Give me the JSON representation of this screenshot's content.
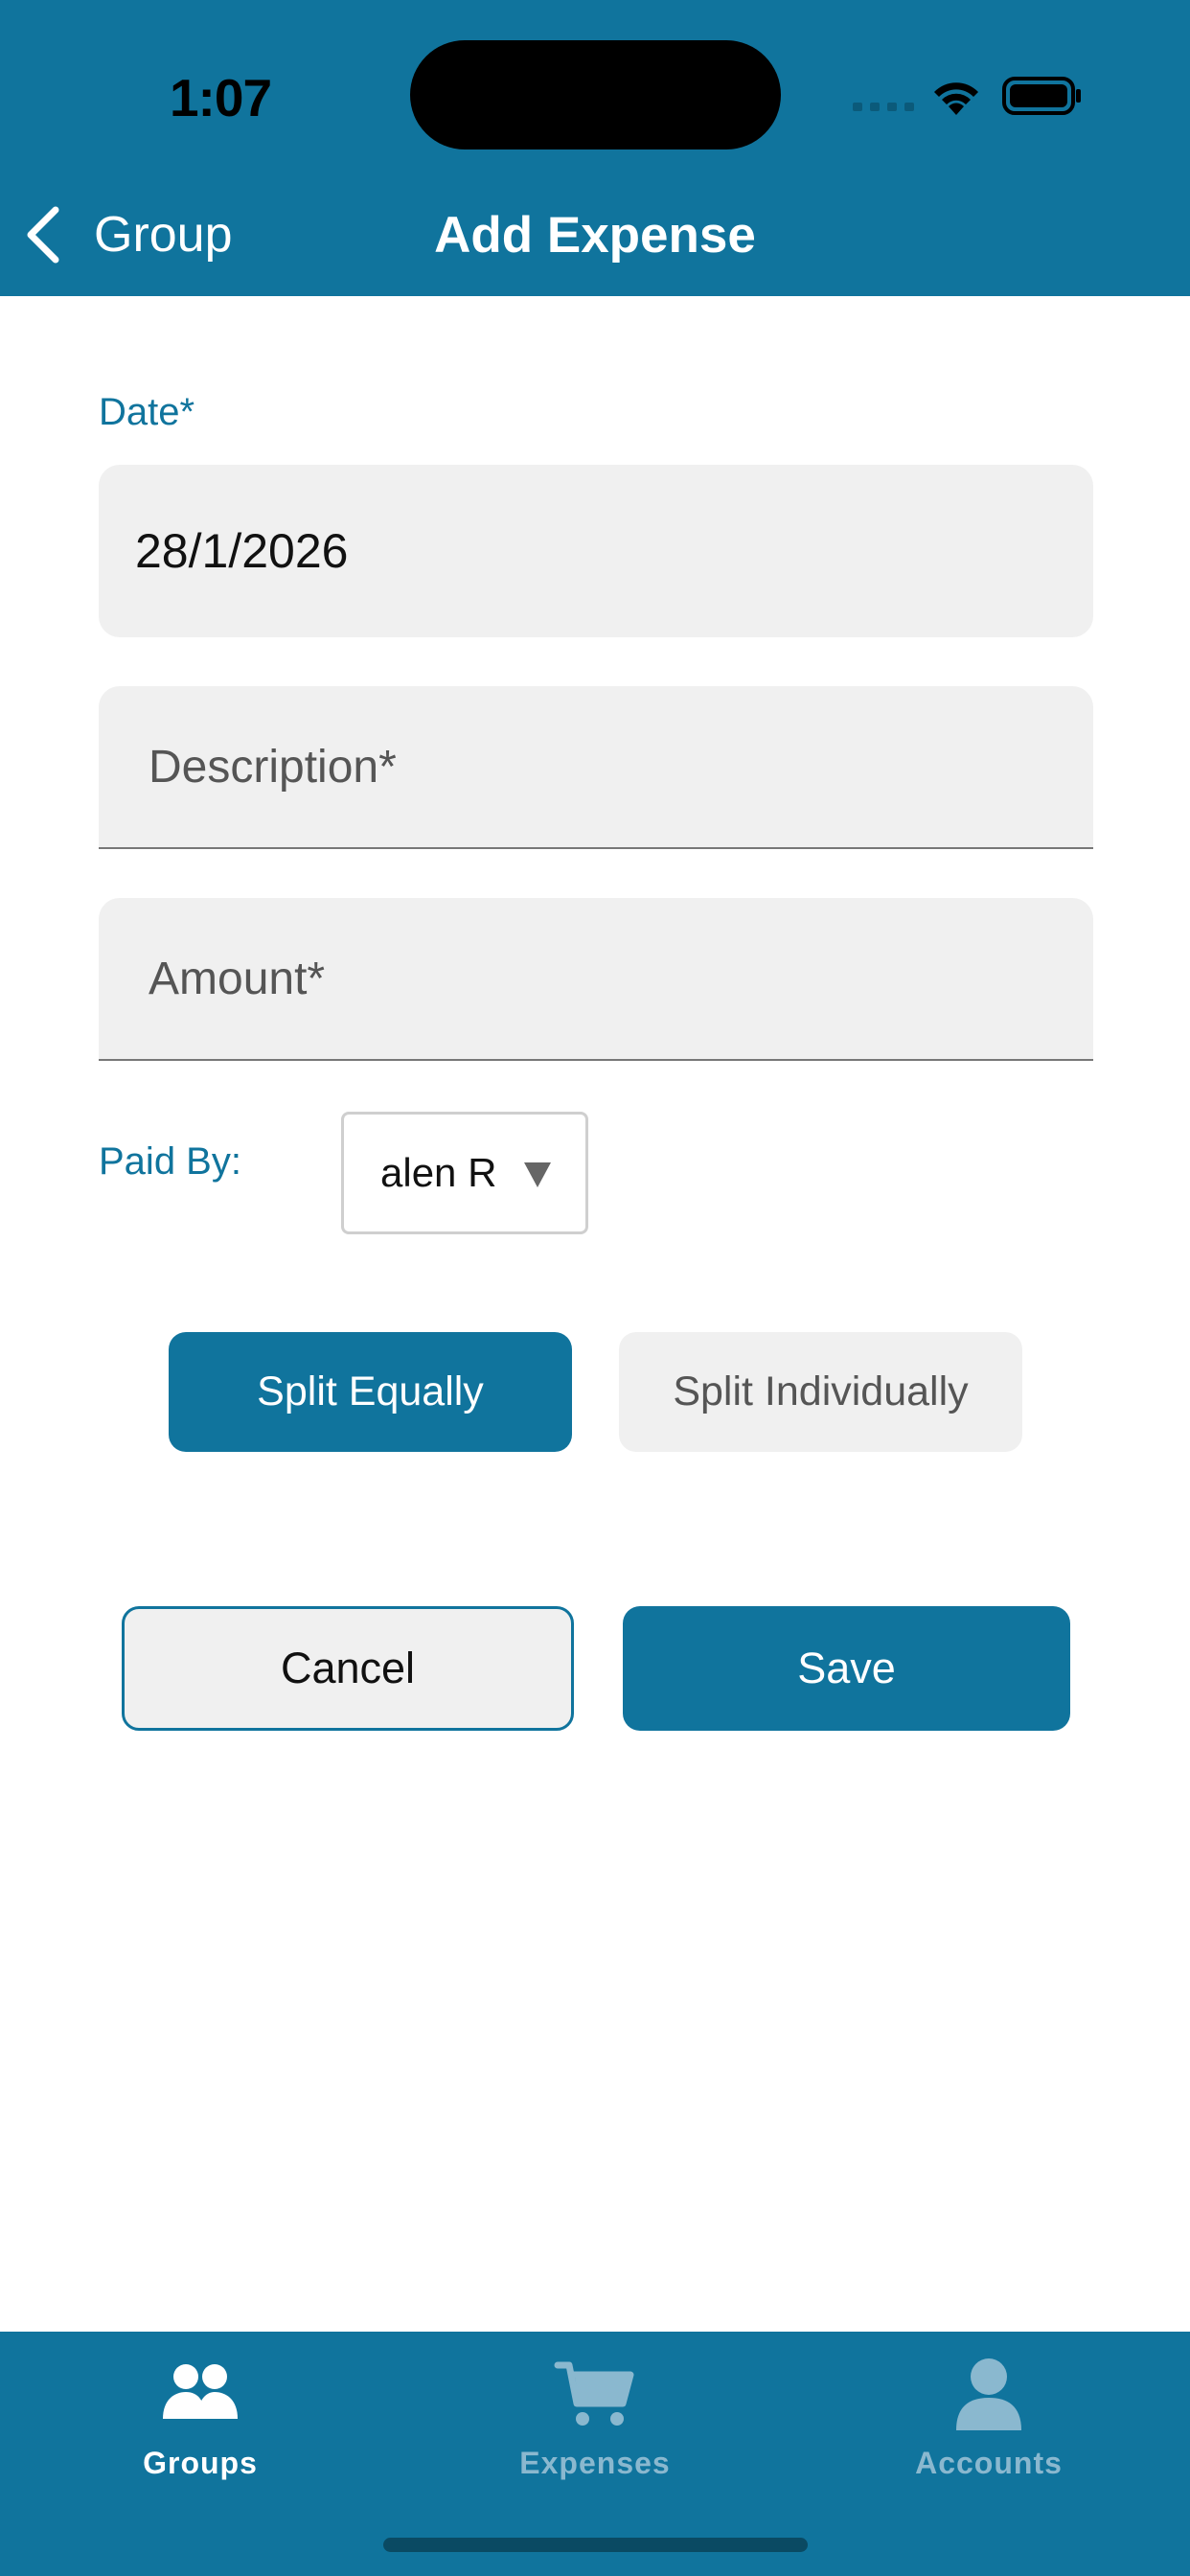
{
  "status_bar": {
    "time": "1:07"
  },
  "header": {
    "back_label": "Group",
    "title": "Add Expense"
  },
  "form": {
    "date_label": "Date*",
    "date_value": "28/1/2026",
    "description_placeholder": "Description*",
    "amount_placeholder": "Amount*",
    "paid_by_label": "Paid By:",
    "paid_by_value": "alen R"
  },
  "split": {
    "equal_label": "Split Equally",
    "individual_label": "Split Individually",
    "selected": "equal"
  },
  "actions": {
    "cancel_label": "Cancel",
    "save_label": "Save"
  },
  "tabbar": {
    "tabs": [
      {
        "label": "Groups",
        "icon": "groups-icon",
        "active": true
      },
      {
        "label": "Expenses",
        "icon": "cart-icon",
        "active": false
      },
      {
        "label": "Accounts",
        "icon": "person-icon",
        "active": false
      }
    ]
  },
  "colors": {
    "primary": "#10749d",
    "field_bg": "#f0f0f0",
    "inactive_tab": "#8ab8cf"
  }
}
